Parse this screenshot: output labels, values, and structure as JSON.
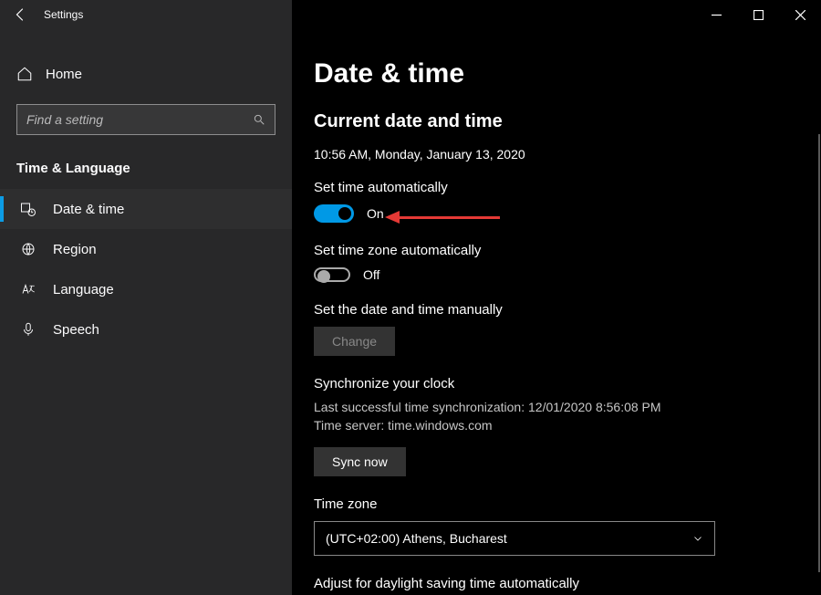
{
  "window": {
    "title": "Settings"
  },
  "sidebar": {
    "home_label": "Home",
    "search_placeholder": "Find a setting",
    "section_label": "Time & Language",
    "items": [
      {
        "label": "Date & time"
      },
      {
        "label": "Region"
      },
      {
        "label": "Language"
      },
      {
        "label": "Speech"
      }
    ]
  },
  "page": {
    "title": "Date & time",
    "current_section": "Current date and time",
    "current_value": "10:56 AM, Monday, January 13, 2020",
    "set_time_auto": {
      "label": "Set time automatically",
      "state": "On"
    },
    "set_tz_auto": {
      "label": "Set time zone automatically",
      "state": "Off"
    },
    "manual": {
      "label": "Set the date and time manually",
      "button": "Change"
    },
    "sync": {
      "label": "Synchronize your clock",
      "last": "Last successful time synchronization: 12/01/2020 8:56:08 PM",
      "server": "Time server: time.windows.com",
      "button": "Sync now"
    },
    "timezone": {
      "label": "Time zone",
      "value": "(UTC+02:00) Athens, Bucharest"
    },
    "dst": {
      "label": "Adjust for daylight saving time automatically"
    }
  }
}
